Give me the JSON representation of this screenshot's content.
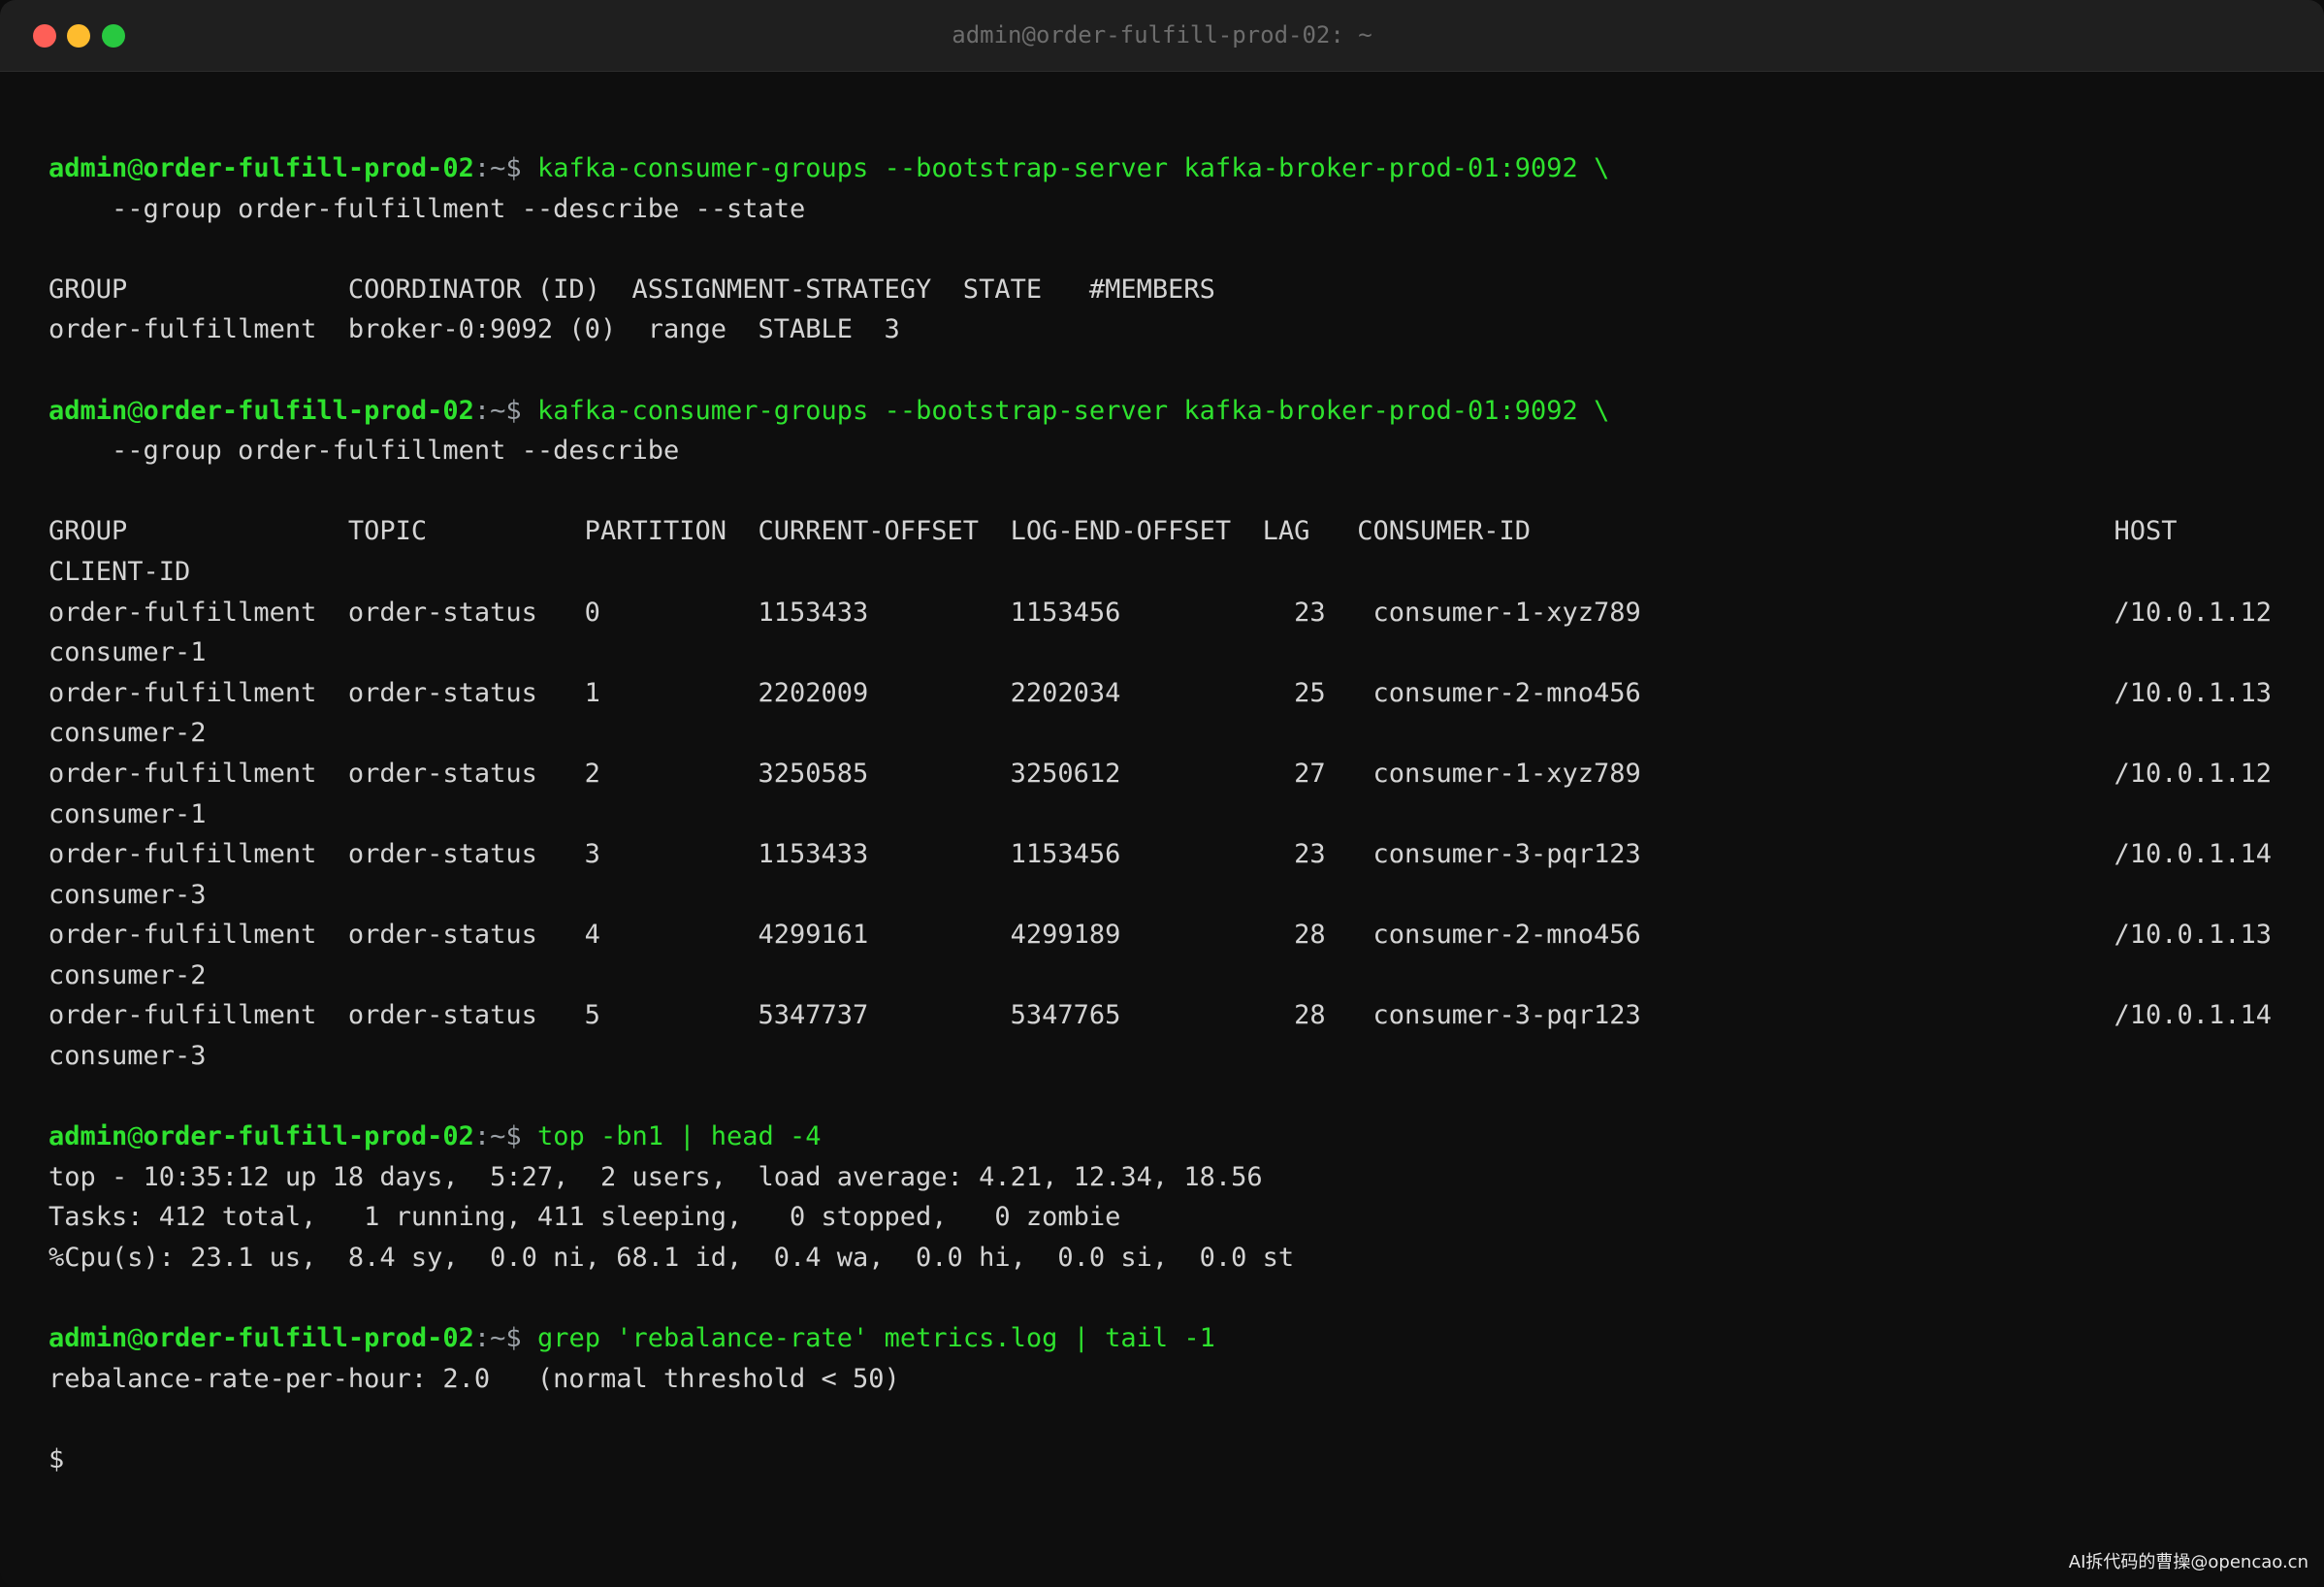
{
  "window": {
    "title": "admin@order-fulfill-prod-02: ~"
  },
  "prompt": {
    "user": "admin",
    "at": "@",
    "host": "order-fulfill-prod-02",
    "path": ":~$ "
  },
  "blocks": [
    {
      "command": "kafka-consumer-groups --bootstrap-server kafka-broker-prod-01:9092 \\",
      "continuation": "    --group order-fulfillment --describe --state",
      "output": [
        "",
        "GROUP              COORDINATOR (ID)  ASSIGNMENT-STRATEGY  STATE   #MEMBERS",
        "order-fulfillment  broker-0:9092 (0)  range  STABLE  3",
        ""
      ]
    },
    {
      "command": "kafka-consumer-groups --bootstrap-server kafka-broker-prod-01:9092 \\",
      "continuation": "    --group order-fulfillment --describe",
      "output": [
        "",
        "GROUP              TOPIC          PARTITION  CURRENT-OFFSET  LOG-END-OFFSET  LAG   CONSUMER-ID                                     HOST",
        "CLIENT-ID",
        "order-fulfillment  order-status   0          1153433         1153456           23   consumer-1-xyz789                              /10.0.1.12",
        "consumer-1",
        "order-fulfillment  order-status   1          2202009         2202034           25   consumer-2-mno456                              /10.0.1.13",
        "consumer-2",
        "order-fulfillment  order-status   2          3250585         3250612           27   consumer-1-xyz789                              /10.0.1.12",
        "consumer-1",
        "order-fulfillment  order-status   3          1153433         1153456           23   consumer-3-pqr123                              /10.0.1.14",
        "consumer-3",
        "order-fulfillment  order-status   4          4299161         4299189           28   consumer-2-mno456                              /10.0.1.13",
        "consumer-2",
        "order-fulfillment  order-status   5          5347737         5347765           28   consumer-3-pqr123                              /10.0.1.14",
        "consumer-3",
        ""
      ]
    },
    {
      "command": "top -bn1 | head -4",
      "continuation": null,
      "output": [
        "top - 10:35:12 up 18 days,  5:27,  2 users,  load average: 4.21, 12.34, 18.56",
        "Tasks: 412 total,   1 running, 411 sleeping,   0 stopped,   0 zombie",
        "%Cpu(s): 23.1 us,  8.4 sy,  0.0 ni, 68.1 id,  0.4 wa,  0.0 hi,  0.0 si,  0.0 st",
        ""
      ]
    },
    {
      "command": "grep 'rebalance-rate' metrics.log | tail -1",
      "continuation": null,
      "output": [
        "rebalance-rate-per-hour: 2.0   (normal threshold < 50)",
        ""
      ]
    }
  ],
  "final_prompt": "$",
  "watermark": "AI拆代码的曹操@opencao.cn",
  "colors": {
    "prompt_green": "#2ee22e",
    "output_text": "#d4d4d4",
    "background": "#0e0e0e",
    "titlebar": "#1f1f1f"
  }
}
